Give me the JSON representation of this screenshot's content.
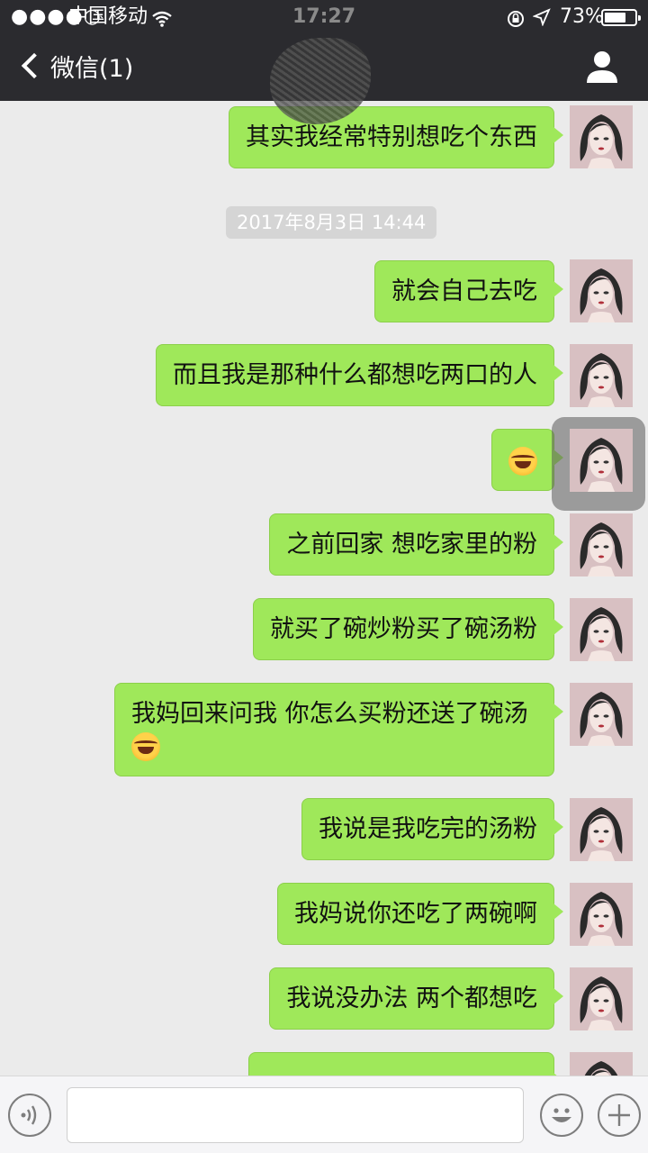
{
  "status_bar": {
    "signal": "●●●●○",
    "carrier": "中国移动",
    "time": "17:27",
    "battery_percent": "73%",
    "battery_level": 0.73
  },
  "nav": {
    "back_label": "微信(1)"
  },
  "timestamp": "2017年8月3日 14:44",
  "messages": [
    {
      "text": "其实我经常特别想吃个东西"
    },
    {
      "text": "就会自己去吃"
    },
    {
      "text": "而且我是那种什么都想吃两口的人"
    },
    {
      "text": ""
    },
    {
      "text": "之前回家 想吃家里的粉"
    },
    {
      "text": "就买了碗炒粉买了碗汤粉"
    },
    {
      "text": "我妈回来问我 你怎么买粉还送了碗汤"
    },
    {
      "text": "我说是我吃完的汤粉"
    },
    {
      "text": "我妈说你还吃了两碗啊"
    },
    {
      "text": "我说没办法 两个都想吃"
    }
  ],
  "colors": {
    "bubble": "#9fe85a",
    "nav_bg": "#2b2b2f",
    "chat_bg": "#ebebeb"
  }
}
